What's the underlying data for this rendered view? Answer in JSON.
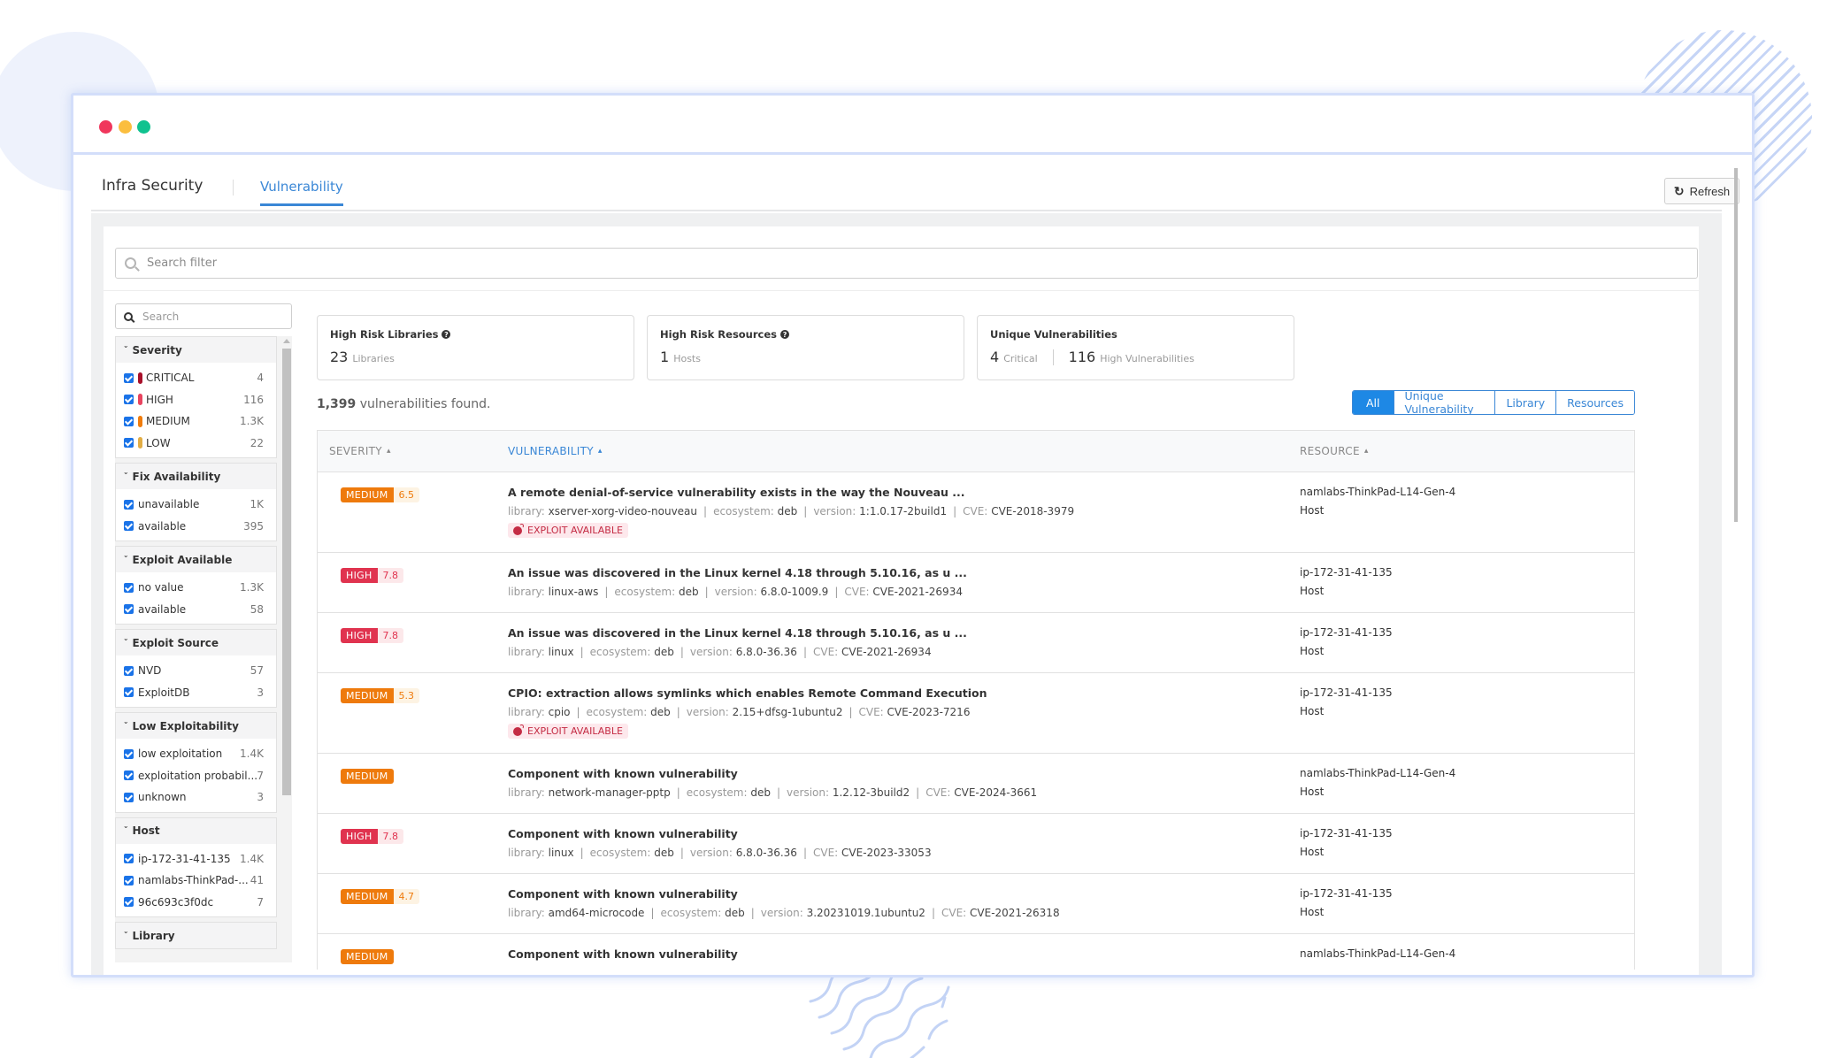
{
  "window": {
    "controls": [
      "close",
      "minimize",
      "maximize"
    ]
  },
  "header": {
    "title": "Infra Security",
    "active_tab": "Vulnerability",
    "refresh_label": "Refresh",
    "refresh_icon": "refresh-icon"
  },
  "search_filter": {
    "placeholder": "Search filter",
    "value": ""
  },
  "sidebar": {
    "search_placeholder": "Search",
    "facets": [
      {
        "title": "Severity",
        "items": [
          {
            "label": "CRITICAL",
            "count": "4",
            "checked": true,
            "color": "#a8102a"
          },
          {
            "label": "HIGH",
            "count": "116",
            "checked": true,
            "color": "#e8445f"
          },
          {
            "label": "MEDIUM",
            "count": "1.3K",
            "checked": true,
            "color": "#f07c0c"
          },
          {
            "label": "LOW",
            "count": "22",
            "checked": true,
            "color": "#e2ad45"
          }
        ]
      },
      {
        "title": "Fix Availability",
        "items": [
          {
            "label": "unavailable",
            "count": "1K",
            "checked": true
          },
          {
            "label": "available",
            "count": "395",
            "checked": true
          }
        ]
      },
      {
        "title": "Exploit Available",
        "items": [
          {
            "label": "no value",
            "count": "1.3K",
            "checked": true
          },
          {
            "label": "available",
            "count": "58",
            "checked": true
          }
        ]
      },
      {
        "title": "Exploit Source",
        "items": [
          {
            "label": "NVD",
            "count": "57",
            "checked": true
          },
          {
            "label": "ExploitDB",
            "count": "3",
            "checked": true
          }
        ]
      },
      {
        "title": "Low Exploitability",
        "items": [
          {
            "label": "low exploitation",
            "count": "1.4K",
            "checked": true
          },
          {
            "label": "exploitation probabil...",
            "count": "7",
            "checked": true
          },
          {
            "label": "unknown",
            "count": "3",
            "checked": true
          }
        ]
      },
      {
        "title": "Host",
        "items": [
          {
            "label": "ip-172-31-41-135",
            "count": "1.4K",
            "checked": true
          },
          {
            "label": "namlabs-ThinkPad-...",
            "count": "41",
            "checked": true
          },
          {
            "label": "96c693c3f0dc",
            "count": "7",
            "checked": true
          }
        ]
      },
      {
        "title": "Library",
        "items": []
      }
    ]
  },
  "cards": [
    {
      "title": "High Risk Libraries",
      "help": true,
      "value": "23",
      "unit": "Libraries"
    },
    {
      "title": "High Risk Resources",
      "help": true,
      "value": "1",
      "unit": "Hosts"
    },
    {
      "title": "Unique Vulnerabilities",
      "help": false,
      "value": "4",
      "unit": "Critical",
      "value2": "116",
      "unit2": "High Vulnerabilities"
    }
  ],
  "summary": {
    "count": "1,399",
    "text": "vulnerabilities found."
  },
  "view_toggle": {
    "options": [
      "All",
      "Unique Vulnerability",
      "Library",
      "Resources"
    ],
    "selected": "All"
  },
  "table": {
    "columns": {
      "severity": "SEVERITY",
      "vulnerability": "VULNERABILITY",
      "resource": "RESOURCE"
    },
    "sorted_column": "vulnerability",
    "meta_labels": {
      "library": "library:",
      "ecosystem": "ecosystem:",
      "version": "version:",
      "cve": "CVE:"
    },
    "exploit_label": "EXPLOIT AVAILABLE",
    "rows": [
      {
        "severity": "MEDIUM",
        "score": "6.5",
        "title": "A remote denial-of-service vulnerability exists in the way the Nouveau ...",
        "library": "xserver-xorg-video-nouveau",
        "ecosystem": "deb",
        "version": "1:1.0.17-2build1",
        "cve": "CVE-2018-3979",
        "exploit": true,
        "resource": "namlabs-ThinkPad-L14-Gen-4",
        "resource_type": "Host"
      },
      {
        "severity": "HIGH",
        "score": "7.8",
        "title": "An issue was discovered in the Linux kernel 4.18 through 5.10.16, as u ...",
        "library": "linux-aws",
        "ecosystem": "deb",
        "version": "6.8.0-1009.9",
        "cve": "CVE-2021-26934",
        "exploit": false,
        "resource": "ip-172-31-41-135",
        "resource_type": "Host"
      },
      {
        "severity": "HIGH",
        "score": "7.8",
        "title": "An issue was discovered in the Linux kernel 4.18 through 5.10.16, as u ...",
        "library": "linux",
        "ecosystem": "deb",
        "version": "6.8.0-36.36",
        "cve": "CVE-2021-26934",
        "exploit": false,
        "resource": "ip-172-31-41-135",
        "resource_type": "Host"
      },
      {
        "severity": "MEDIUM",
        "score": "5.3",
        "title": "CPIO: extraction allows symlinks which enables Remote Command Execution",
        "library": "cpio",
        "ecosystem": "deb",
        "version": "2.15+dfsg-1ubuntu2",
        "cve": "CVE-2023-7216",
        "exploit": true,
        "resource": "ip-172-31-41-135",
        "resource_type": "Host"
      },
      {
        "severity": "MEDIUM",
        "score": "",
        "title": "Component with known vulnerability",
        "library": "network-manager-pptp",
        "ecosystem": "deb",
        "version": "1.2.12-3build2",
        "cve": "CVE-2024-3661",
        "exploit": false,
        "resource": "namlabs-ThinkPad-L14-Gen-4",
        "resource_type": "Host"
      },
      {
        "severity": "HIGH",
        "score": "7.8",
        "title": "Component with known vulnerability",
        "library": "linux",
        "ecosystem": "deb",
        "version": "6.8.0-36.36",
        "cve": "CVE-2023-33053",
        "exploit": false,
        "resource": "ip-172-31-41-135",
        "resource_type": "Host"
      },
      {
        "severity": "MEDIUM",
        "score": "4.7",
        "title": "Component with known vulnerability",
        "library": "amd64-microcode",
        "ecosystem": "deb",
        "version": "3.20231019.1ubuntu2",
        "cve": "CVE-2021-26318",
        "exploit": false,
        "resource": "ip-172-31-41-135",
        "resource_type": "Host"
      },
      {
        "severity": "MEDIUM",
        "score": "",
        "title": "Component with known vulnerability",
        "resource": "namlabs-ThinkPad-L14-Gen-4",
        "partial": true
      }
    ]
  },
  "colors": {
    "accent": "#3a87d6",
    "medium": "#ee7a0c",
    "high": "#e0334f",
    "exploit": "#c42c44"
  }
}
